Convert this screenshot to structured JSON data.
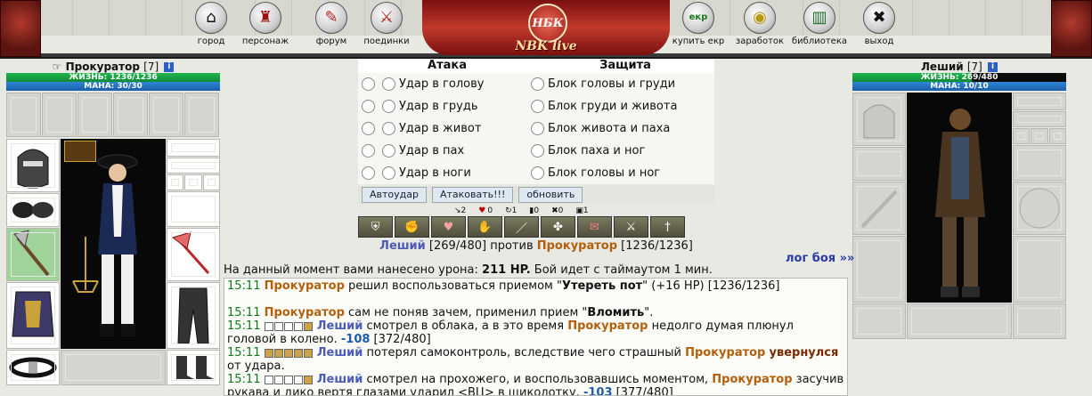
{
  "nav": {
    "items": [
      {
        "label": "город",
        "icon": "house-icon",
        "glyph": "⌂"
      },
      {
        "label": "персонаж",
        "icon": "shirt-icon",
        "glyph": "👕"
      },
      {
        "label": "форум",
        "icon": "feather-pen-icon",
        "glyph": "✎"
      },
      {
        "label": "поединки",
        "icon": "crossed-swords-icon",
        "glyph": "⚔"
      },
      {
        "label": "купить екр",
        "icon": "ekr-coin-icon",
        "glyph": "екр"
      },
      {
        "label": "заработок",
        "icon": "coin-stack-icon",
        "glyph": "◉"
      },
      {
        "label": "библиотека",
        "icon": "library-icon",
        "glyph": "▥"
      },
      {
        "label": "выход",
        "icon": "exit-x-icon",
        "glyph": "✖"
      }
    ],
    "logo_medal": "НБК",
    "logo_title": "NBK live"
  },
  "player_left": {
    "name": "Прокуратор",
    "level": "[7]",
    "hp_label": "ЖИЗНЬ: 1236/1236",
    "hp_fraction": 1.0,
    "mana_label": "МАНА: 30/30"
  },
  "player_right": {
    "name": "Леший",
    "level": "[7]",
    "hp_label": "ЖИЗНЬ: 269/480",
    "hp_fraction": 0.56,
    "mana_label": "МАНА: 10/10"
  },
  "battle": {
    "attack_header": "Атака",
    "defense_header": "Защита",
    "attacks": [
      "Удар в голову",
      "Удар в грудь",
      "Удар в живот",
      "Удар в пах",
      "Удар в ноги"
    ],
    "blocks": [
      "Блок головы и груди",
      "Блок груди и живота",
      "Блок живота и паха",
      "Блок паха и ног",
      "Блок головы и ног"
    ],
    "buttons": {
      "auto": "Автоудар",
      "attack": "Атаковать!!!",
      "refresh": "обновить"
    },
    "stats": [
      "2",
      "0",
      "1",
      "0",
      "0",
      "1"
    ],
    "vs": {
      "p1": "Леший",
      "p1_hp": "[269/480]",
      "word": "против",
      "p2": "Прокуратор",
      "p2_hp": "[1236/1236]"
    },
    "log_link": "лог боя »»",
    "damage": {
      "pre": "На данный момент вами нанесено урона: ",
      "value": "211 HP.",
      "post": " Бой идет с таймаутом 1 мин."
    }
  },
  "log": [
    {
      "time": "15:11",
      "text": "Прокуратор решил воспользоваться приемом \"Утереть пот\" (+16 HP) [1236/1236]"
    },
    {
      "time": "15:11",
      "text": "Прокуратор сам не поняв зачем, применил прием \"Вломить\"."
    },
    {
      "time": "15:11",
      "text": "Леший смотрел в облака, а в это время Прокуратор недолго думая плюнул головой в колено. -108 [372/480]"
    },
    {
      "time": "15:11",
      "text": "Леший потерял самоконтроль, вследствие чего страшный Прокуратор увернулся от удара."
    },
    {
      "time": "15:11",
      "text": "Леший смотрел на прохожего, и воспользовавшись моментом, Прокуратор засучив рукава и дико вертя глазами ударил <ВЦ> в щиколотку. -103 [377/480]"
    }
  ]
}
